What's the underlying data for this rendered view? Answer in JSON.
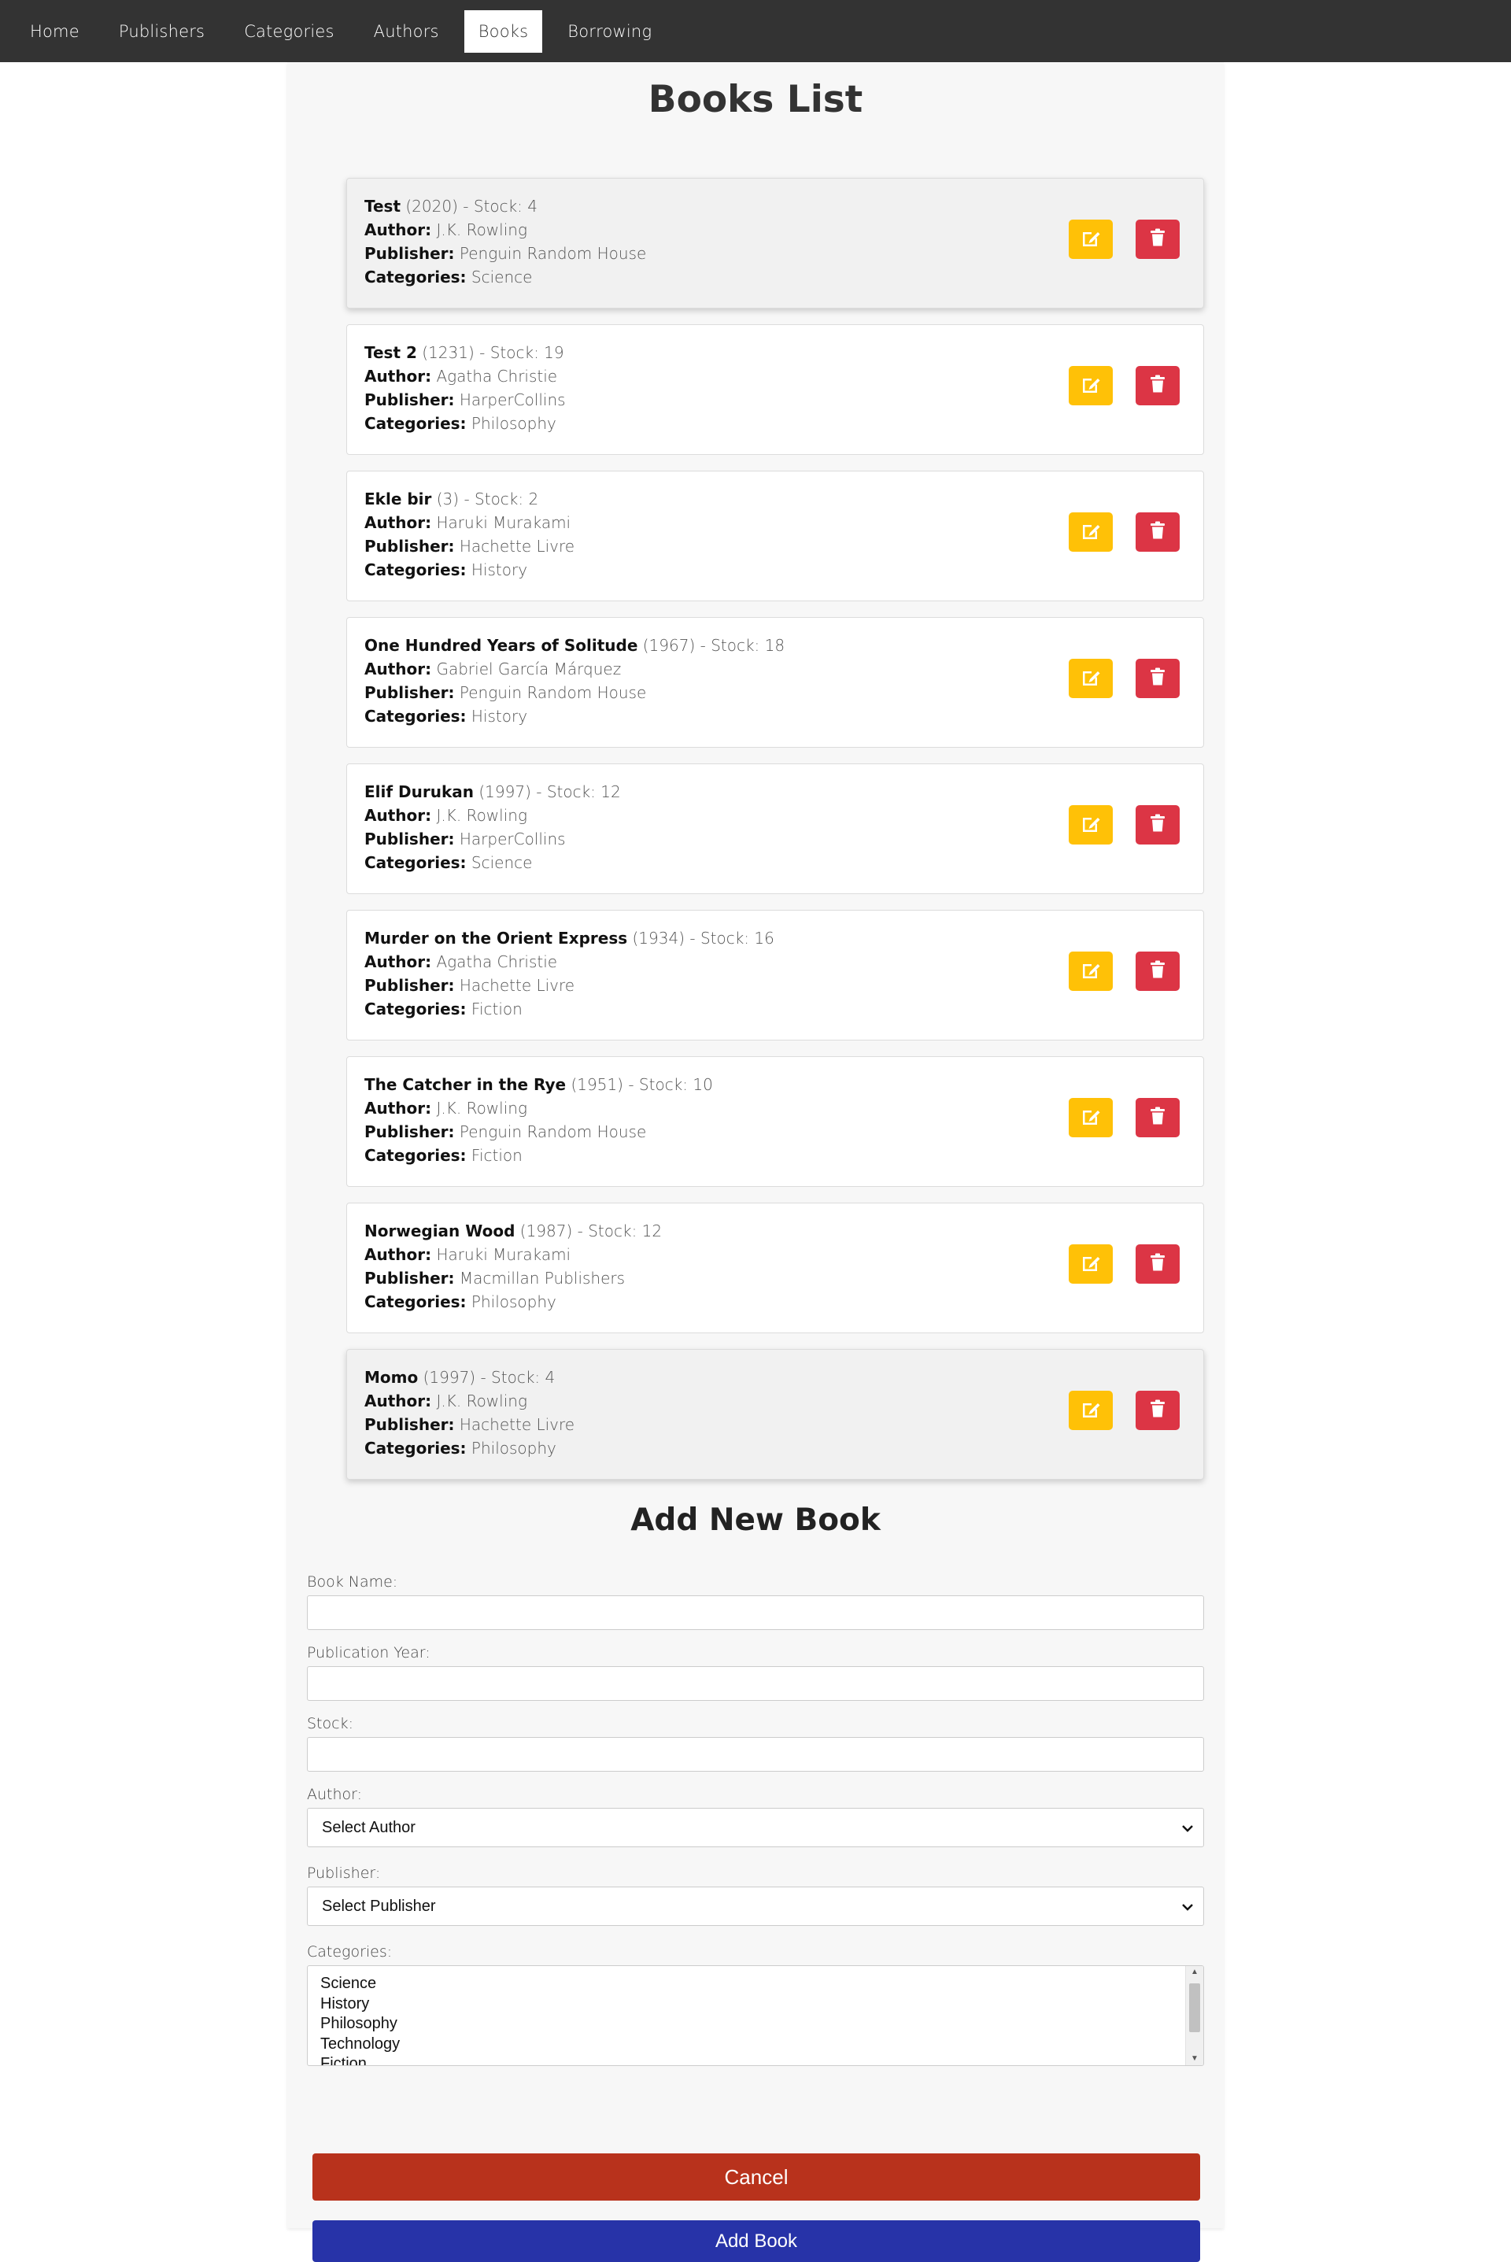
{
  "nav": {
    "items": [
      "Home",
      "Publishers",
      "Categories",
      "Authors",
      "Books",
      "Borrowing"
    ],
    "active": "Books"
  },
  "page_title": "Books List",
  "labels": {
    "author": "Author:",
    "publisher": "Publisher:",
    "categories": "Categories:"
  },
  "books": [
    {
      "title": "Test",
      "year": "(2020)",
      "stock": "- Stock: 4",
      "author": "J.K. Rowling",
      "publisher": "Penguin Random House",
      "categories": "Science",
      "highlight": true
    },
    {
      "title": "Test 2",
      "year": "(1231)",
      "stock": "- Stock: 19",
      "author": "Agatha Christie",
      "publisher": "HarperCollins",
      "categories": "Philosophy",
      "highlight": false
    },
    {
      "title": "Ekle bir",
      "year": "(3)",
      "stock": "- Stock: 2",
      "author": "Haruki Murakami",
      "publisher": "Hachette Livre",
      "categories": "History",
      "highlight": false
    },
    {
      "title": "One Hundred Years of Solitude",
      "year": "(1967)",
      "stock": "- Stock: 18",
      "author": "Gabriel García Márquez",
      "publisher": "Penguin Random House",
      "categories": "History",
      "highlight": false
    },
    {
      "title": "Elif Durukan",
      "year": "(1997)",
      "stock": "- Stock: 12",
      "author": "J.K. Rowling",
      "publisher": "HarperCollins",
      "categories": "Science",
      "highlight": false
    },
    {
      "title": "Murder on the Orient Express",
      "year": "(1934)",
      "stock": "- Stock: 16",
      "author": "Agatha Christie",
      "publisher": "Hachette Livre",
      "categories": "Fiction",
      "highlight": false
    },
    {
      "title": "The Catcher in the Rye",
      "year": "(1951)",
      "stock": "- Stock: 10",
      "author": "J.K. Rowling",
      "publisher": "Penguin Random House",
      "categories": "Fiction",
      "highlight": false
    },
    {
      "title": "Norwegian Wood",
      "year": "(1987)",
      "stock": "- Stock: 12",
      "author": "Haruki Murakami",
      "publisher": "Macmillan Publishers",
      "categories": "Philosophy",
      "highlight": false
    },
    {
      "title": "Momo",
      "year": "(1997)",
      "stock": "- Stock: 4",
      "author": "J.K. Rowling",
      "publisher": "Hachette Livre",
      "categories": "Philosophy",
      "highlight": true
    }
  ],
  "form": {
    "title": "Add New Book",
    "book_name_label": "Book Name:",
    "book_name_value": "",
    "year_label": "Publication Year:",
    "year_value": "",
    "stock_label": "Stock:",
    "stock_value": "",
    "author_label": "Author:",
    "author_selected": "Select Author",
    "publisher_label": "Publisher:",
    "publisher_selected": "Select Publisher",
    "categories_label": "Categories:",
    "category_options": [
      "Science",
      "History",
      "Philosophy",
      "Technology",
      "Fiction"
    ],
    "cancel_label": "Cancel",
    "submit_label": "Add Book"
  },
  "colors": {
    "edit": "#ffc107",
    "delete": "#dc3545",
    "cancel": "#b8321c",
    "submit": "#2733a8",
    "navbar": "#333333"
  },
  "icons": {
    "edit": "pencil-square-icon",
    "delete": "trash-icon",
    "select": "chevron-down-icon"
  }
}
